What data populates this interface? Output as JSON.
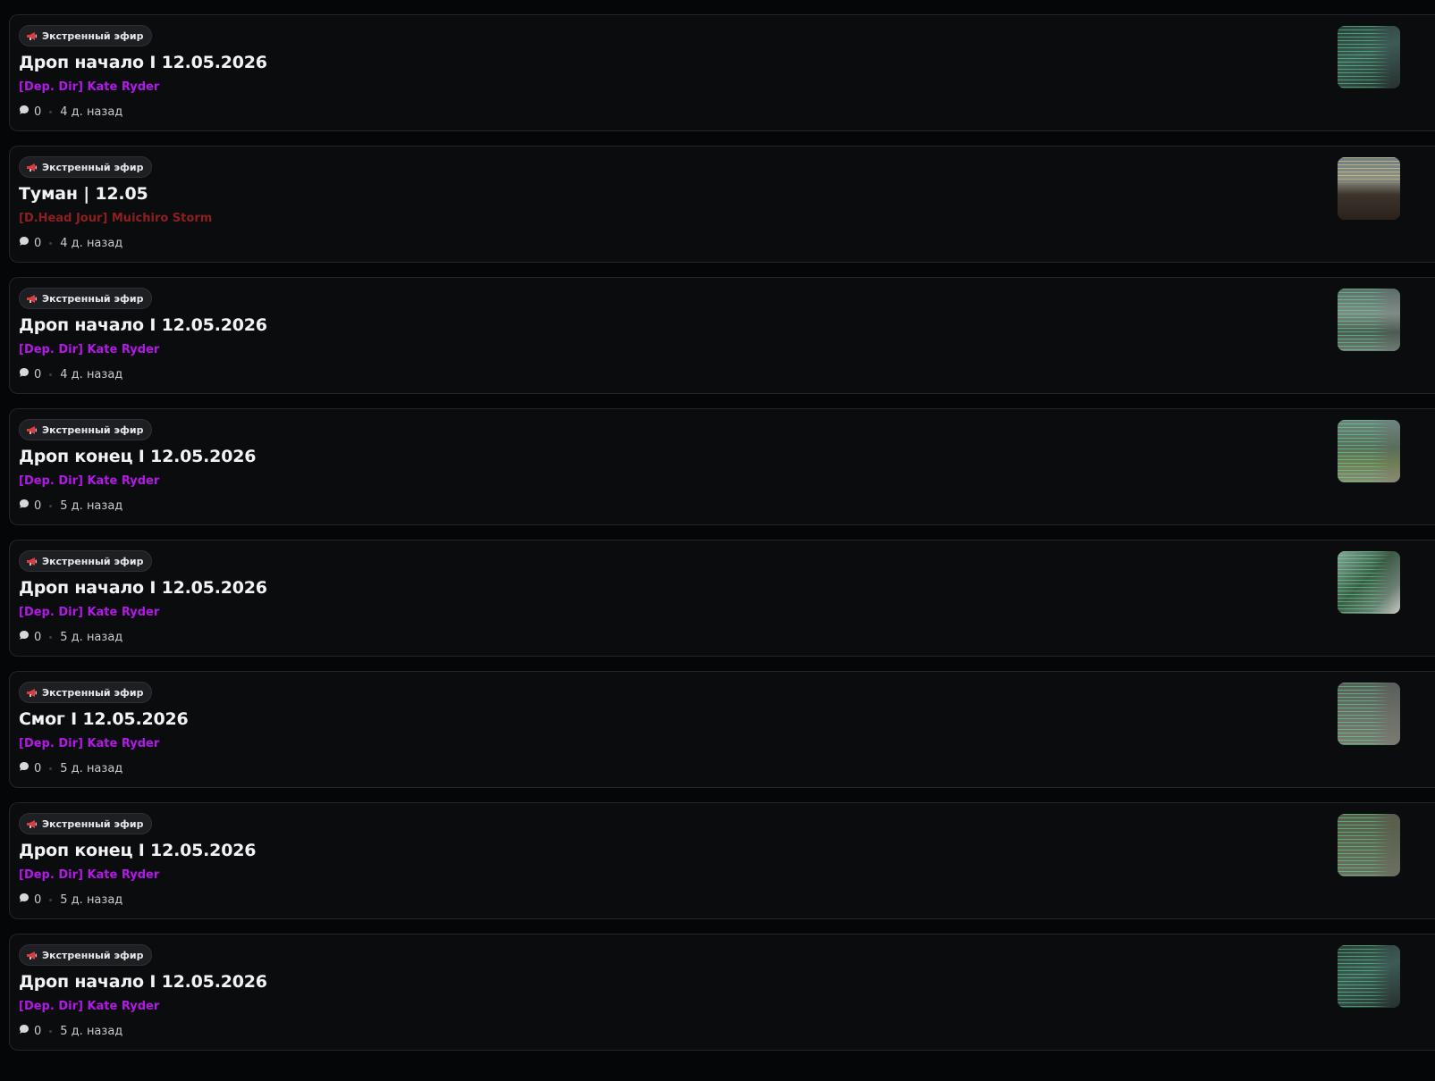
{
  "posts": [
    {
      "badge": "Экстренный эфир",
      "title": "Дроп начало I 12.05.2026",
      "author": "[Dep. Dir] Kate Ryder",
      "author_color": "#b219e6",
      "comments": "0",
      "time": "4 д. назад",
      "thumb_variant": "dark-green"
    },
    {
      "badge": "Экстренный эфир",
      "title": "Туман | 12.05",
      "author": "[D.Head Jour] Muichiro Storm",
      "author_color": "#8e1f1f",
      "comments": "0",
      "time": "4 д. назад",
      "thumb_variant": "yellow-chat"
    },
    {
      "badge": "Экстренный эфир",
      "title": "Дроп начало I 12.05.2026",
      "author": "[Dep. Dir] Kate Ryder",
      "author_color": "#b219e6",
      "comments": "0",
      "time": "4 д. назад",
      "thumb_variant": "grey-green"
    },
    {
      "badge": "Экстренный эфир",
      "title": "Дроп конец I 12.05.2026",
      "author": "[Dep. Dir] Kate Ryder",
      "author_color": "#b219e6",
      "comments": "0",
      "time": "5 д. назад",
      "thumb_variant": "field"
    },
    {
      "badge": "Экстренный эфир",
      "title": "Дроп начало I 12.05.2026",
      "author": "[Dep. Dir] Kate Ryder",
      "author_color": "#b219e6",
      "comments": "0",
      "time": "5 д. назад",
      "thumb_variant": "palm"
    },
    {
      "badge": "Экстренный эфир",
      "title": "Смог I 12.05.2026",
      "author": "[Dep. Dir] Kate Ryder",
      "author_color": "#b219e6",
      "comments": "0",
      "time": "5 д. назад",
      "thumb_variant": "grey"
    },
    {
      "badge": "Экстренный эфир",
      "title": "Дроп конец I 12.05.2026",
      "author": "[Dep. Dir] Kate Ryder",
      "author_color": "#b219e6",
      "comments": "0",
      "time": "5 д. назад",
      "thumb_variant": "olive"
    },
    {
      "badge": "Экстренный эфир",
      "title": "Дроп начало I 12.05.2026",
      "author": "[Dep. Dir] Kate Ryder",
      "author_color": "#b219e6",
      "comments": "0",
      "time": "5 д. назад",
      "thumb_variant": "dark-green"
    }
  ],
  "icons": {
    "badge": "megaphone-icon",
    "comments": "comment-bubble-icon"
  },
  "colors": {
    "page_background": "#050607",
    "card_background": "#0b0c0e",
    "card_border": "#24262b",
    "badge_background": "#1d1f23",
    "megaphone_red": "#e0393e"
  }
}
